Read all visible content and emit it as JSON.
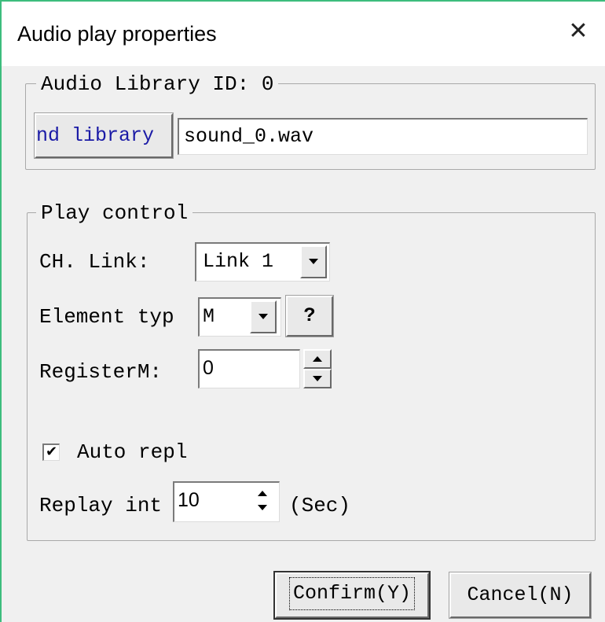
{
  "window": {
    "title": "Audio play properties",
    "close_icon": "close-icon"
  },
  "library_group": {
    "legend": "Audio Library ID: 0",
    "library_button_label": "nd library",
    "file_value": "sound_0.wav"
  },
  "play_control": {
    "legend": "Play control",
    "ch_link": {
      "label": "CH. Link:",
      "value": "Link 1"
    },
    "element_type": {
      "label": "Element typ",
      "value": "M",
      "help_label": "?"
    },
    "register": {
      "label": "RegisterM:",
      "value": "0"
    },
    "auto_replay": {
      "label": "Auto repl",
      "checked": true,
      "check_mark": "✔"
    },
    "replay_interval": {
      "label": "Replay int",
      "value": "10",
      "unit": "(Sec)"
    }
  },
  "buttons": {
    "confirm_label": "Confirm(Y)",
    "cancel_label": "Cancel(N)"
  },
  "colors": {
    "window_border_accent": "#3dbd7d",
    "library_button_text": "#1a1aa6",
    "dialog_background": "#f0f0f0"
  }
}
